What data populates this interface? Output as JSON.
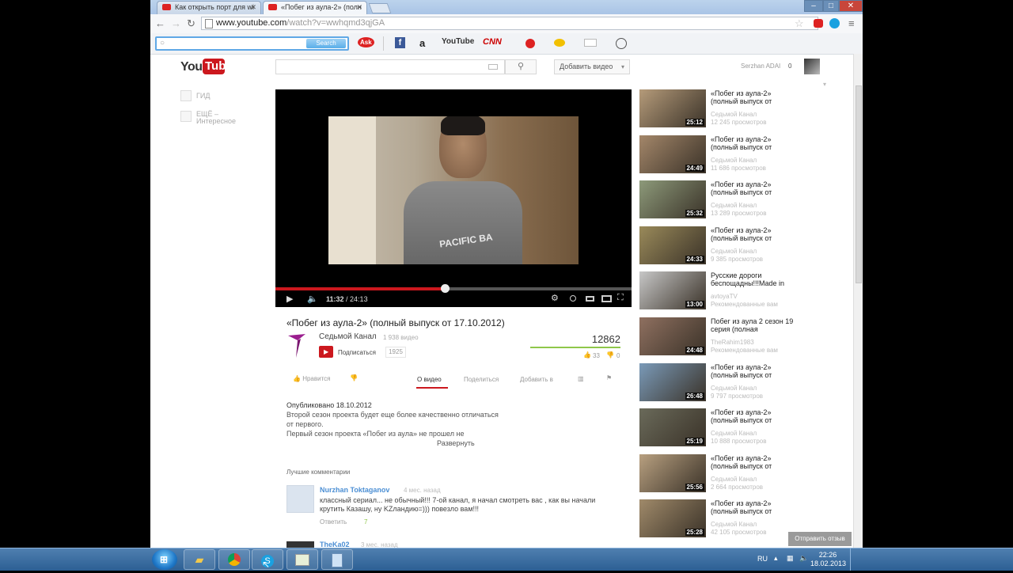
{
  "browser": {
    "tabs": [
      {
        "label": "Как открыть порт для wi",
        "active": false
      },
      {
        "label": "«Побег из аула-2» (полн",
        "active": true
      }
    ],
    "window_controls": [
      "–",
      "□",
      "✕"
    ],
    "url_host": "www.youtube.com",
    "url_path": "/watch?v=wwhqmd3qjGA",
    "search_button": "Search"
  },
  "toolbar_items": {
    "ask": "Ask",
    "facebook": "f",
    "amazon": "a",
    "youtube": "YouTube",
    "cnn": "CNN"
  },
  "masthead": {
    "logo_you": "You",
    "logo_tube": "Tube",
    "upload_label": "Добавить видео",
    "user_name": "Serzhan ADAI",
    "notifications": "0"
  },
  "guide": {
    "items": [
      "ГИД",
      "ЕЩЁ –",
      "Интересное"
    ]
  },
  "player": {
    "time_current": "11:32",
    "time_total": "24:13",
    "progress": 0.476,
    "frame_text": "PACIFIC BA"
  },
  "video": {
    "title": "«Побег из аула-2» (полный выпуск от 17.10.2012)",
    "channel": "Седьмой Канал",
    "channel_videos": "1 938 видео",
    "subscribe_label": "Подписаться",
    "subscribers": "1925",
    "views": "12862",
    "likes": "33",
    "dislikes": "0",
    "actions": {
      "like": "Нравится",
      "about": "О видео",
      "share": "Поделиться",
      "add_to": "Добавить в"
    },
    "published": "Опубликовано 18.10.2012",
    "description": [
      "Второй сезон проекта будет еще более качественно отличаться",
      "от первого.",
      "Первый сезон проекта «Побег из аула» не прошел не"
    ],
    "show_more": "Развернуть"
  },
  "comments": {
    "heading": "Лучшие комментарии",
    "items": [
      {
        "user": "Nurzhan Toktaganov",
        "time": "4 мес. назад",
        "text": "классный сериал... не обычный!!! 7-ой канал, я начал смотреть вас , как вы начали крутить Казашу, ну KZландию=))) повезло вам!!!",
        "reply": "Ответить",
        "score": "7"
      },
      {
        "user": "TheKa02",
        "time": "3 мес. назад"
      }
    ]
  },
  "related": [
    {
      "title": "«Побег из аула-2» (полный выпуск от",
      "channel": "Седьмой Канал",
      "views": "12 245 просмотров",
      "duration": "25:12",
      "color": "#b59b7a"
    },
    {
      "title": "«Побег из аула-2» (полный выпуск от",
      "channel": "Седьмой Канал",
      "views": "11 686 просмотров",
      "duration": "24:49",
      "color": "#a4876a"
    },
    {
      "title": "«Побег из аула-2» (полный выпуск от",
      "channel": "Седьмой Канал",
      "views": "13 289 просмотров",
      "duration": "25:32",
      "color": "#8d9a7a"
    },
    {
      "title": "«Побег из аула-2» (полный выпуск от",
      "channel": "Седьмой Канал",
      "views": "9 385 просмотров",
      "duration": "24:33",
      "color": "#9a8a5a"
    },
    {
      "title": "Русские дороги беспощадны!!!Made in",
      "channel": "avtoyaTV",
      "views": "Рекомендованные вам",
      "duration": "13:00",
      "color": "#c7c7c7"
    },
    {
      "title": "Побег из аула 2 сезон 19 серия (полная",
      "channel": "TheRahim1983",
      "views": "Рекомендованные вам",
      "duration": "24:48",
      "color": "#8f7060"
    },
    {
      "title": "«Побег из аула-2» (полный выпуск от",
      "channel": "Седьмой Канал",
      "views": "9 797 просмотров",
      "duration": "26:48",
      "color": "#7a9ab8"
    },
    {
      "title": "«Побег из аула-2» (полный выпуск от",
      "channel": "Седьмой Канал",
      "views": "10 888 просмотров",
      "duration": "25:19",
      "color": "#6a6a5a"
    },
    {
      "title": "«Побег из аула-2» (полный выпуск от",
      "channel": "Седьмой Канал",
      "views": "2 664 просмотров",
      "duration": "25:56",
      "color": "#b8a080"
    },
    {
      "title": "«Побег из аула-2» (полный выпуск от",
      "channel": "Седьмой Канал",
      "views": "42 105 просмотров",
      "duration": "25:28",
      "color": "#a08a6a"
    }
  ],
  "feedback_button": "Отправить отзыв",
  "taskbar": {
    "lang": "RU",
    "time": "22:26",
    "date": "18.02.2013"
  }
}
